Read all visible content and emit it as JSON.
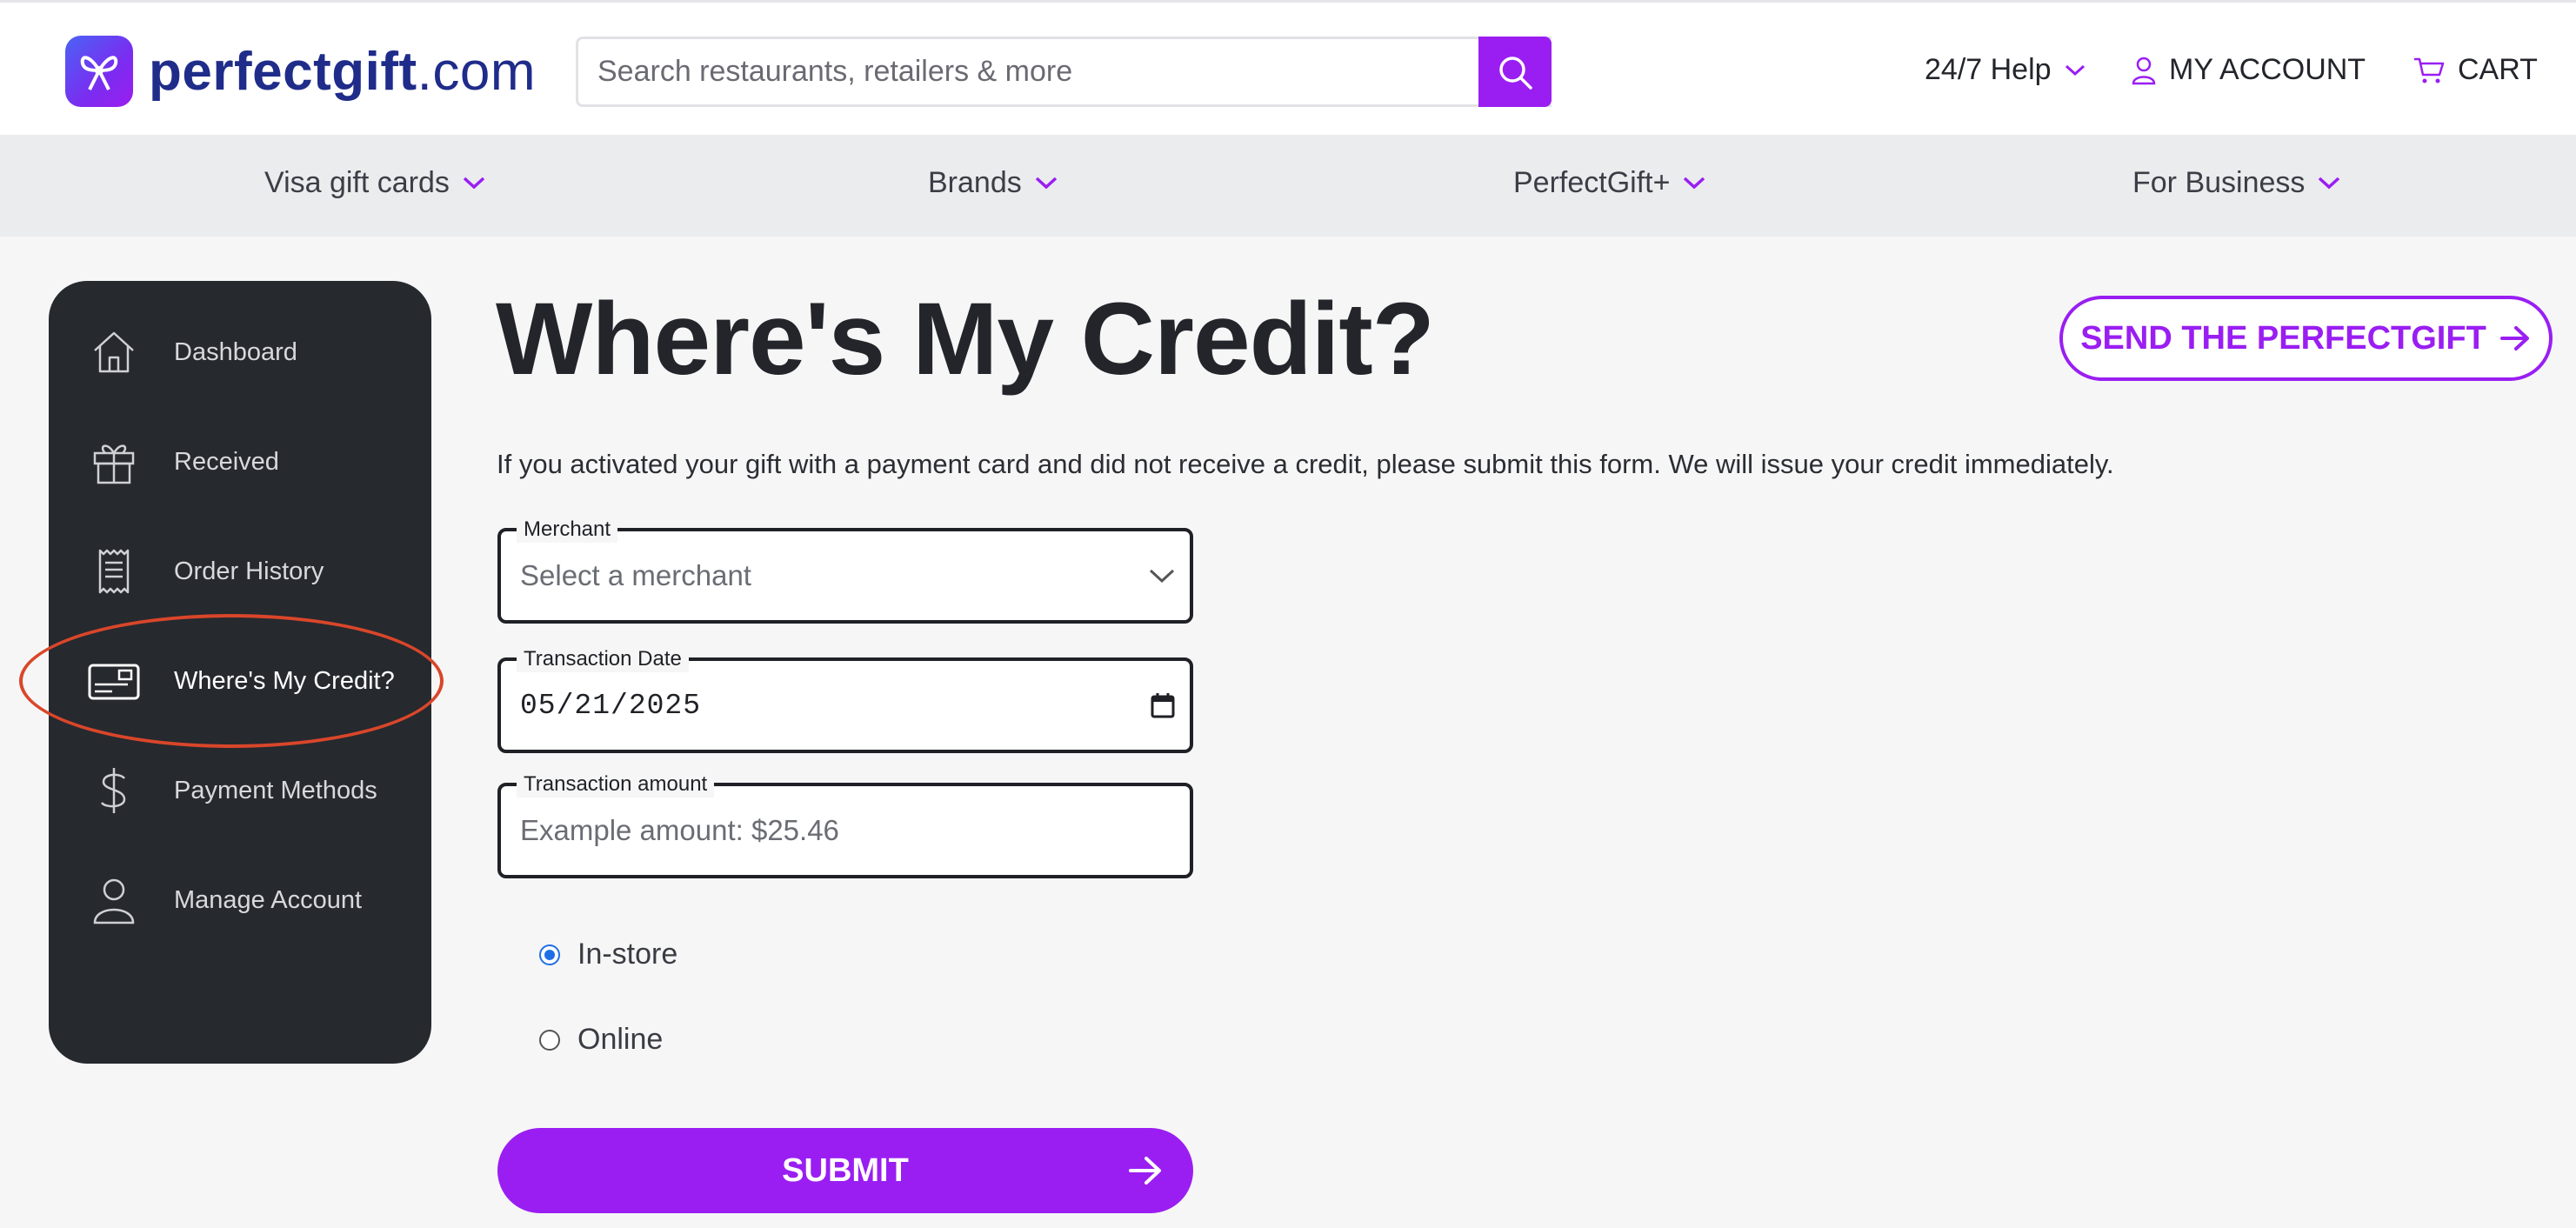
{
  "header": {
    "logo_text": "perfectgift",
    "logo_suffix": ".com",
    "search_placeholder": "Search restaurants, retailers & more",
    "help_label": "24/7 Help",
    "account_label": "MY ACCOUNT",
    "cart_label": "CART"
  },
  "nav": {
    "items": [
      {
        "label": "Visa gift cards"
      },
      {
        "label": "Brands"
      },
      {
        "label": "PerfectGift+"
      },
      {
        "label": "For Business"
      }
    ]
  },
  "sidebar": {
    "items": [
      {
        "label": "Dashboard",
        "icon": "home-icon"
      },
      {
        "label": "Received",
        "icon": "gift-icon"
      },
      {
        "label": "Order History",
        "icon": "receipt-icon"
      },
      {
        "label": "Where's My Credit?",
        "icon": "credit-card-icon",
        "active": true
      },
      {
        "label": "Payment Methods",
        "icon": "dollar-icon"
      },
      {
        "label": "Manage Account",
        "icon": "user-icon"
      }
    ]
  },
  "main": {
    "title": "Where's My Credit?",
    "send_button_label": "SEND THE PERFECTGIFT",
    "intro": "If you activated your gift with a payment card and did not receive a credit, please submit this form. We will issue your credit immediately.",
    "form": {
      "merchant_label": "Merchant",
      "merchant_placeholder": "Select a merchant",
      "date_label": "Transaction Date",
      "date_value": "05/21/2025",
      "amount_label": "Transaction amount",
      "amount_placeholder": "Example amount: $25.46",
      "radio_instore": "In-store",
      "radio_online": "Online",
      "selected_radio": "In-store",
      "submit_label": "SUBMIT"
    }
  },
  "colors": {
    "brand_purple": "#9a1ef2",
    "sidebar_bg": "#26292e",
    "annotation_red": "#d9462a"
  }
}
